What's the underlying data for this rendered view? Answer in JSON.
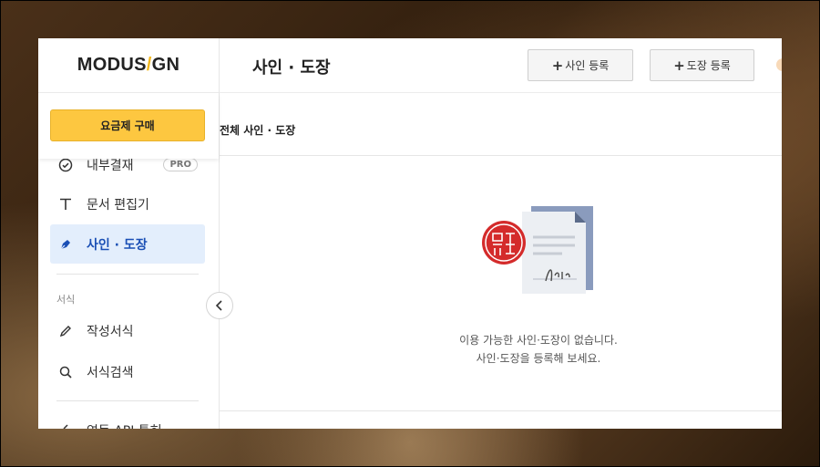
{
  "app": {
    "logo_left": "MODUS",
    "logo_slash": "/",
    "logo_right": "GN"
  },
  "sidebar": {
    "buy_button": "요금제 구매",
    "items": [
      {
        "label": "내부결재",
        "icon": "check-circle-icon",
        "badge": "PRO"
      },
      {
        "label": "문서 편집기",
        "icon": "text-t-icon"
      },
      {
        "label": "사인 · 도장",
        "icon": "pen-nib-icon",
        "active": true
      }
    ],
    "section_forms": "서식",
    "form_items": [
      {
        "label": "작성서식",
        "icon": "pencil-icon"
      },
      {
        "label": "서식검색",
        "icon": "search-icon"
      }
    ],
    "bottom_item": "연동 API 특허"
  },
  "header": {
    "title": "사인 · 도장",
    "add_sign": "사인 등록",
    "add_stamp": "도장 등록",
    "plus": "+"
  },
  "main": {
    "section_title": "전체 사인 · 도장",
    "empty_line1": "이용 가능한 사인·도장이 없습니다.",
    "empty_line2": "사인·도장을 등록해 보세요."
  },
  "colors": {
    "accent_yellow": "#fdc740",
    "active_bg": "#e3eefc",
    "active_text": "#1a4fb5",
    "stamp_red": "#d42b2b",
    "doc_blue": "#8a9bbd"
  }
}
